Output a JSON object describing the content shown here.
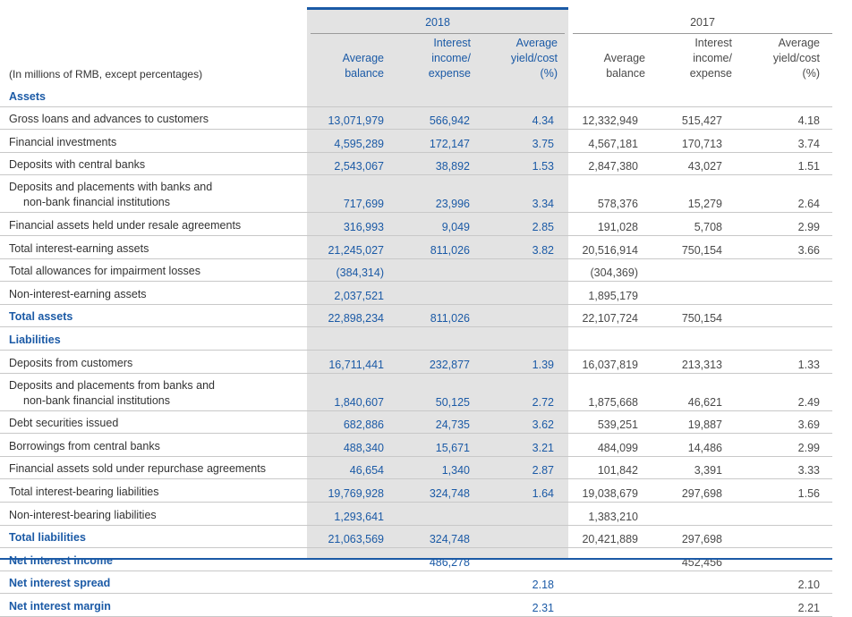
{
  "header": {
    "unit_note": "(In millions of RMB, except percentages)",
    "year_2018": "2018",
    "year_2017": "2017",
    "col_balance": [
      "Average",
      "balance"
    ],
    "col_interest": [
      "Interest",
      "income/",
      "expense"
    ],
    "col_yield": [
      "Average",
      "yield/cost",
      "(%)"
    ]
  },
  "rows": [
    {
      "type": "section",
      "label": "Assets"
    },
    {
      "type": "data",
      "label": "Gross loans and advances to customers",
      "v": [
        "13,071,979",
        "566,942",
        "4.34",
        "12,332,949",
        "515,427",
        "4.18"
      ]
    },
    {
      "type": "data",
      "label": "Financial investments",
      "v": [
        "4,595,289",
        "172,147",
        "3.75",
        "4,567,181",
        "170,713",
        "3.74"
      ]
    },
    {
      "type": "data",
      "label": "Deposits with central banks",
      "v": [
        "2,543,067",
        "38,892",
        "1.53",
        "2,847,380",
        "43,027",
        "1.51"
      ]
    },
    {
      "type": "two",
      "label": "Deposits and placements with banks and",
      "label2": "non-bank financial institutions",
      "v": [
        "717,699",
        "23,996",
        "3.34",
        "578,376",
        "15,279",
        "2.64"
      ]
    },
    {
      "type": "data",
      "label": "Financial assets held under resale agreements",
      "v": [
        "316,993",
        "9,049",
        "2.85",
        "191,028",
        "5,708",
        "2.99"
      ]
    },
    {
      "type": "data",
      "label": "Total interest-earning assets",
      "v": [
        "21,245,027",
        "811,026",
        "3.82",
        "20,516,914",
        "750,154",
        "3.66"
      ]
    },
    {
      "type": "data",
      "label": "Total allowances for impairment losses",
      "v": [
        "(384,314)",
        "",
        "",
        "(304,369)",
        "",
        ""
      ]
    },
    {
      "type": "data",
      "label": "Non-interest-earning assets",
      "v": [
        "2,037,521",
        "",
        "",
        "1,895,179",
        "",
        ""
      ]
    },
    {
      "type": "bold",
      "label": "Total assets",
      "v": [
        "22,898,234",
        "811,026",
        "",
        "22,107,724",
        "750,154",
        ""
      ]
    },
    {
      "type": "section",
      "label": "Liabilities"
    },
    {
      "type": "data",
      "label": "Deposits from customers",
      "v": [
        "16,711,441",
        "232,877",
        "1.39",
        "16,037,819",
        "213,313",
        "1.33"
      ]
    },
    {
      "type": "two",
      "label": "Deposits and placements from banks and",
      "label2": "non-bank financial institutions",
      "v": [
        "1,840,607",
        "50,125",
        "2.72",
        "1,875,668",
        "46,621",
        "2.49"
      ]
    },
    {
      "type": "data",
      "label": "Debt securities issued",
      "v": [
        "682,886",
        "24,735",
        "3.62",
        "539,251",
        "19,887",
        "3.69"
      ]
    },
    {
      "type": "data",
      "label": "Borrowings from central banks",
      "v": [
        "488,340",
        "15,671",
        "3.21",
        "484,099",
        "14,486",
        "2.99"
      ]
    },
    {
      "type": "data",
      "label": "Financial assets sold under repurchase agreements",
      "v": [
        "46,654",
        "1,340",
        "2.87",
        "101,842",
        "3,391",
        "3.33"
      ]
    },
    {
      "type": "data",
      "label": "Total interest-bearing liabilities",
      "v": [
        "19,769,928",
        "324,748",
        "1.64",
        "19,038,679",
        "297,698",
        "1.56"
      ]
    },
    {
      "type": "data",
      "label": "Non-interest-bearing liabilities",
      "v": [
        "1,293,641",
        "",
        "",
        "1,383,210",
        "",
        ""
      ]
    },
    {
      "type": "bold",
      "label": "Total liabilities",
      "v": [
        "21,063,569",
        "324,748",
        "",
        "20,421,889",
        "297,698",
        ""
      ]
    },
    {
      "type": "bold",
      "label": "Net interest income",
      "v": [
        "",
        "486,278",
        "",
        "",
        "452,456",
        ""
      ]
    },
    {
      "type": "bold",
      "label": "Net interest spread",
      "v": [
        "",
        "",
        "2.18",
        "",
        "",
        "2.10"
      ]
    },
    {
      "type": "bold",
      "label": "Net interest margin",
      "v": [
        "",
        "",
        "2.31",
        "",
        "",
        "2.21"
      ]
    }
  ]
}
